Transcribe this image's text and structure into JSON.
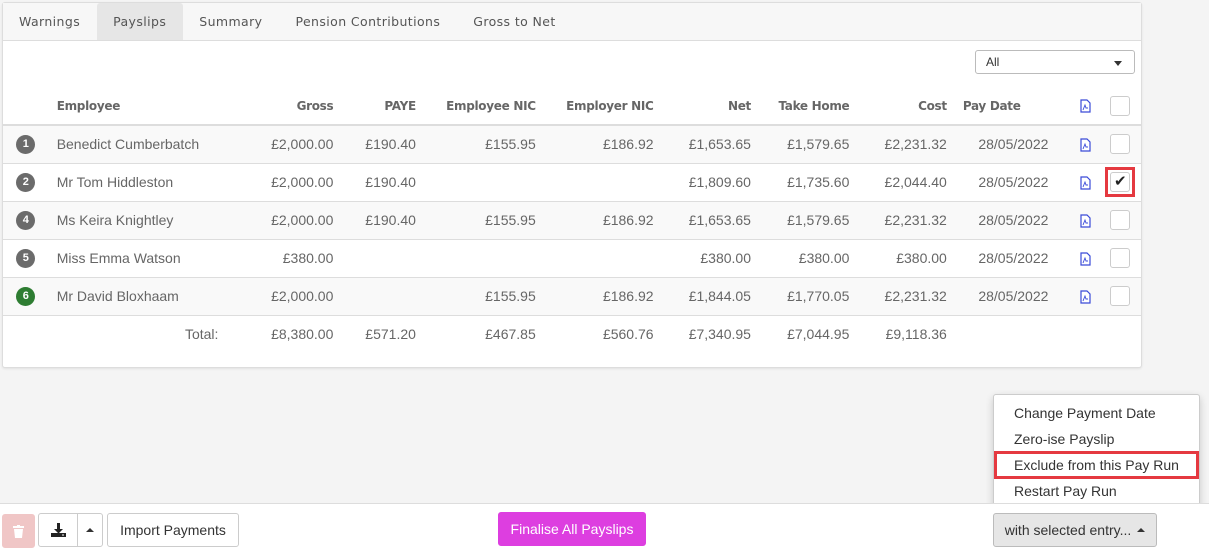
{
  "tabs": [
    {
      "label": "Warnings",
      "active": false
    },
    {
      "label": "Payslips",
      "active": true
    },
    {
      "label": "Summary",
      "active": false
    },
    {
      "label": "Pension Contributions",
      "active": false
    },
    {
      "label": "Gross to Net",
      "active": false
    }
  ],
  "filter": {
    "selected": "All"
  },
  "table": {
    "headers": {
      "employee": "Employee",
      "gross": "Gross",
      "paye": "PAYE",
      "employee_nic": "Employee NIC",
      "employer_nic": "Employer NIC",
      "net": "Net",
      "take_home": "Take Home",
      "cost": "Cost",
      "pay_date": "Pay Date"
    },
    "rows": [
      {
        "num": "1",
        "employee": "Benedict Cumberbatch",
        "gross": "£2,000.00",
        "paye": "£190.40",
        "employee_nic": "£155.95",
        "employer_nic": "£186.92",
        "net": "£1,653.65",
        "take_home": "£1,579.65",
        "cost": "£2,231.32",
        "pay_date": "28/05/2022",
        "checked": false,
        "badge_color": "#6b6b6b"
      },
      {
        "num": "2",
        "employee": "Mr Tom Hiddleston",
        "gross": "£2,000.00",
        "paye": "£190.40",
        "employee_nic": "",
        "employer_nic": "",
        "net": "£1,809.60",
        "take_home": "£1,735.60",
        "cost": "£2,044.40",
        "pay_date": "28/05/2022",
        "checked": true,
        "badge_color": "#6b6b6b"
      },
      {
        "num": "4",
        "employee": "Ms Keira Knightley",
        "gross": "£2,000.00",
        "paye": "£190.40",
        "employee_nic": "£155.95",
        "employer_nic": "£186.92",
        "net": "£1,653.65",
        "take_home": "£1,579.65",
        "cost": "£2,231.32",
        "pay_date": "28/05/2022",
        "checked": false,
        "badge_color": "#6b6b6b"
      },
      {
        "num": "5",
        "employee": "Miss Emma Watson",
        "gross": "£380.00",
        "paye": "",
        "employee_nic": "",
        "employer_nic": "",
        "net": "£380.00",
        "take_home": "£380.00",
        "cost": "£380.00",
        "pay_date": "28/05/2022",
        "checked": false,
        "badge_color": "#6b6b6b"
      },
      {
        "num": "6",
        "employee": "Mr David Bloxhaam",
        "gross": "£2,000.00",
        "paye": "",
        "employee_nic": "£155.95",
        "employer_nic": "£186.92",
        "net": "£1,844.05",
        "take_home": "£1,770.05",
        "cost": "£2,231.32",
        "pay_date": "28/05/2022",
        "checked": false,
        "badge_color": "#2e7d32"
      }
    ],
    "total": {
      "label": "Total:",
      "gross": "£8,380.00",
      "paye": "£571.20",
      "employee_nic": "£467.85",
      "employer_nic": "£560.76",
      "net": "£7,340.95",
      "take_home": "£7,044.95",
      "cost": "£9,118.36"
    }
  },
  "footer": {
    "import_label": "Import Payments",
    "finalise_label": "Finalise All Payslips",
    "selected_label": "with selected entry...",
    "finalise_color": "#dd3ee0"
  },
  "menu": {
    "items": [
      {
        "label": "Change Payment Date"
      },
      {
        "label": "Zero-ise Payslip"
      },
      {
        "label": "Exclude from this Pay Run",
        "highlighted": true
      },
      {
        "label": "Restart Pay Run"
      }
    ]
  }
}
